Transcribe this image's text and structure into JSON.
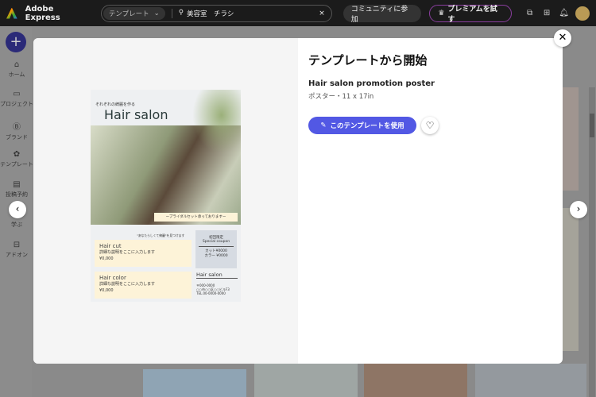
{
  "topbar": {
    "app_name": "Adobe Express",
    "search_scope": "テンプレート",
    "search_query": "美容室　チラシ",
    "community_button": "コミュニティに参加",
    "premium_button": "プレミアムを試す"
  },
  "sidebar": {
    "items": [
      {
        "label": "ホーム",
        "icon": "home-icon"
      },
      {
        "label": "プロジェクト",
        "icon": "folder-icon"
      },
      {
        "label": "ブランド",
        "icon": "brand-icon"
      },
      {
        "label": "テンプレート",
        "icon": "template-icon"
      },
      {
        "label": "投稿予約",
        "icon": "calendar-icon"
      },
      {
        "label": "学ぶ",
        "icon": "learn-icon"
      },
      {
        "label": "アドオン",
        "icon": "addon-icon"
      }
    ]
  },
  "modal": {
    "heading": "テンプレートから開始",
    "template_name": "Hair salon promotion poster",
    "template_meta": "ポスター・11 x 17in",
    "use_button": "このテンプレートを使用"
  },
  "poster": {
    "tagline": "それぞれの綺麗を作る",
    "title": "Hair salon",
    "banner": "ープライダルセット承っておりますー",
    "quote": "\"あなたらしくて綺麗\"を見つけます",
    "items": [
      {
        "name": "Hair cut",
        "desc": "詳細な説明をここに入力します",
        "price": "¥0,000"
      },
      {
        "name": "Hair color",
        "desc": "詳細な説明をここに入力します",
        "price": "¥0,000"
      }
    ],
    "coupon_title": "初回限定",
    "coupon_sub": "Special coupon",
    "coupon_lines": [
      "カット¥0000",
      "カラー ¥0000"
    ],
    "footer_name": "Hair salon",
    "address": [
      "〒000-0000",
      "○○市○○区○○ビルF3",
      "TEL.00-0000-0000"
    ]
  }
}
